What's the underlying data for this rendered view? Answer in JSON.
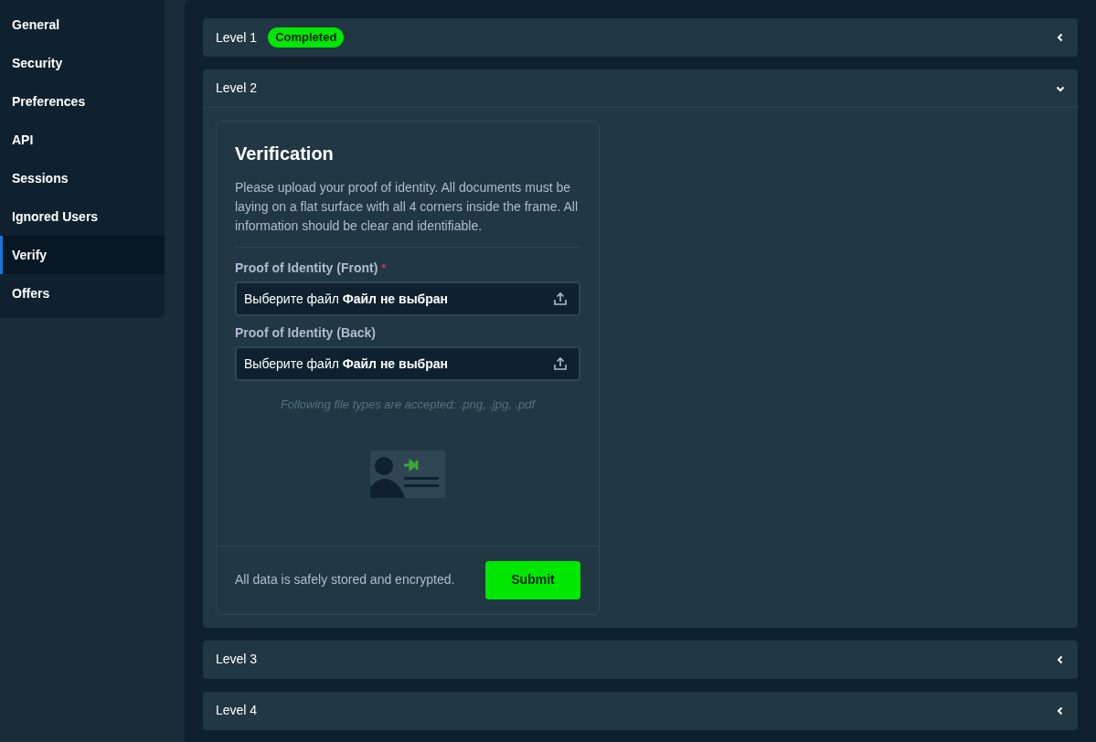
{
  "sidebar": {
    "items": [
      {
        "label": "General",
        "selected": false
      },
      {
        "label": "Security",
        "selected": false
      },
      {
        "label": "Preferences",
        "selected": false
      },
      {
        "label": "API",
        "selected": false
      },
      {
        "label": "Sessions",
        "selected": false
      },
      {
        "label": "Ignored Users",
        "selected": false
      },
      {
        "label": "Verify",
        "selected": true
      },
      {
        "label": "Offers",
        "selected": false
      }
    ]
  },
  "levels": [
    {
      "label": "Level 1",
      "badge": "Completed",
      "expanded": false
    },
    {
      "label": "Level 2",
      "expanded": true,
      "card": {
        "title": "Verification",
        "description": "Please upload your proof of identity. All documents must be laying on a flat surface with all 4 corners inside the frame. All information should be clear and identifiable.",
        "fields": [
          {
            "label": "Proof of Identity (Front)",
            "required": true,
            "button_text": "Выберите файл",
            "status": "Файл не выбран"
          },
          {
            "label": "Proof of Identity (Back)",
            "required": false,
            "button_text": "Выберите файл",
            "status": "Файл не выбран"
          }
        ],
        "required_mark": "*",
        "hint": "Following file types are accepted: .png, .jpg, .pdf",
        "footer_text": "All data is safely stored and encrypted.",
        "submit": "Submit"
      }
    },
    {
      "label": "Level 3",
      "expanded": false
    },
    {
      "label": "Level 4",
      "expanded": false
    }
  ]
}
